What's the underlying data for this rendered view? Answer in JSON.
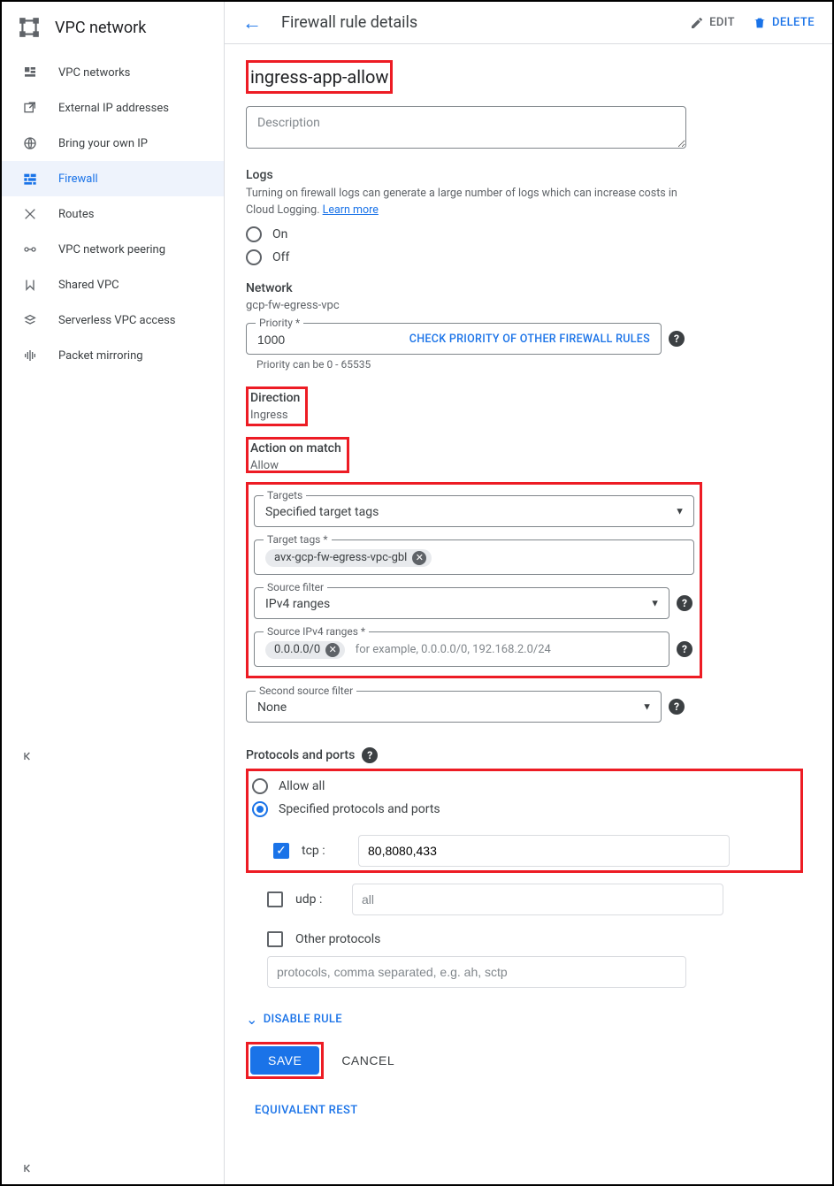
{
  "product": {
    "title": "VPC network"
  },
  "nav": {
    "items": [
      {
        "label": "VPC networks"
      },
      {
        "label": "External IP addresses"
      },
      {
        "label": "Bring your own IP"
      },
      {
        "label": "Firewall"
      },
      {
        "label": "Routes"
      },
      {
        "label": "VPC network peering"
      },
      {
        "label": "Shared VPC"
      },
      {
        "label": "Serverless VPC access"
      },
      {
        "label": "Packet mirroring"
      }
    ]
  },
  "header": {
    "title": "Firewall rule details",
    "edit": "EDIT",
    "delete": "DELETE"
  },
  "rule": {
    "name": "ingress-app-allow",
    "description_placeholder": "Description",
    "logs": {
      "title": "Logs",
      "subtitle": "Turning on firewall logs can generate a large number of logs which can increase costs in Cloud Logging. ",
      "learn_more": "Learn more",
      "on": "On",
      "off": "Off"
    },
    "network": {
      "label": "Network",
      "value": "gcp-fw-egress-vpc"
    },
    "priority": {
      "label": "Priority *",
      "value": "1000",
      "check_link": "CHECK PRIORITY OF OTHER FIREWALL RULES",
      "hint": "Priority can be 0 - 65535"
    },
    "direction": {
      "label": "Direction",
      "value": "Ingress"
    },
    "action": {
      "label": "Action on match",
      "value": "Allow"
    },
    "targets": {
      "label": "Targets",
      "value": "Specified target tags"
    },
    "target_tags": {
      "label": "Target tags *",
      "chip": "avx-gcp-fw-egress-vpc-gbl"
    },
    "source_filter": {
      "label": "Source filter",
      "value": "IPv4 ranges"
    },
    "source_ranges": {
      "label": "Source IPv4 ranges *",
      "chip": "0.0.0.0/0",
      "hint": "for example, 0.0.0.0/0, 192.168.2.0/24"
    },
    "second_source": {
      "label": "Second source filter",
      "value": "None"
    },
    "protocols": {
      "title": "Protocols and ports",
      "allow_all": "Allow all",
      "specified": "Specified protocols and ports",
      "tcp_label": "tcp :",
      "tcp_value": "80,8080,433",
      "udp_label": "udp :",
      "udp_placeholder": "all",
      "other_label": "Other protocols",
      "other_placeholder": "protocols, comma separated, e.g. ah, sctp"
    },
    "disable_rule": "DISABLE RULE",
    "save": "SAVE",
    "cancel": "CANCEL",
    "equiv_rest": "EQUIVALENT REST"
  }
}
